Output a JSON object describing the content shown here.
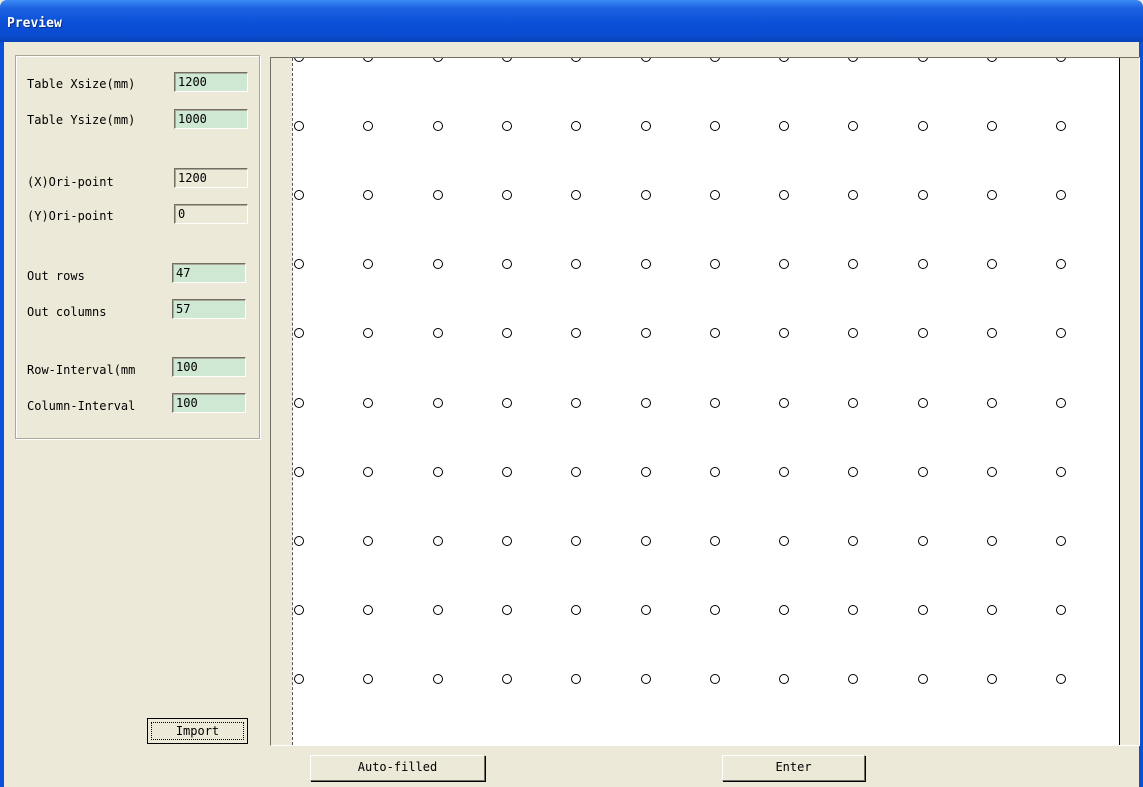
{
  "window": {
    "title": "Preview",
    "accent": "#0a50d8"
  },
  "settings": {
    "table_xsize": {
      "label": "Table Xsize(mm)",
      "value": "1200"
    },
    "table_ysize": {
      "label": "Table Ysize(mm)",
      "value": "1000"
    },
    "x_ori_point": {
      "label": "(X)Ori-point",
      "value": "1200"
    },
    "y_ori_point": {
      "label": "(Y)Ori-point",
      "value": "0"
    },
    "out_rows": {
      "label": "Out rows",
      "value": "47"
    },
    "out_columns": {
      "label": "Out columns",
      "value": "57"
    },
    "row_interval": {
      "label": "Row-Interval(mm",
      "value": "100"
    },
    "column_interval": {
      "label": "Column-Interval",
      "value": "100"
    }
  },
  "buttons": {
    "import": "Import",
    "auto_filled": "Auto-filled",
    "enter": "Enter"
  },
  "preview_grid": {
    "visible_rows": 10,
    "visible_columns": 12,
    "field_bg": "#cfe8d3"
  }
}
